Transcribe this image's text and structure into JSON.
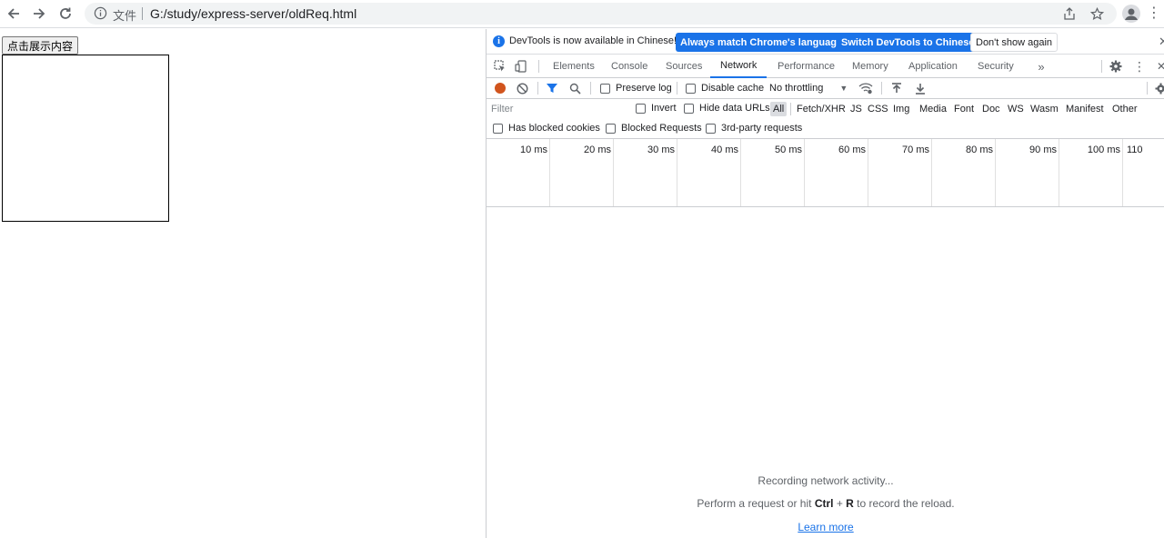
{
  "browser": {
    "protocol_label": "文件",
    "url": "G:/study/express-server/oldReq.html"
  },
  "page": {
    "button_label": "点击展示内容"
  },
  "devtools": {
    "infobar": {
      "text": "DevTools is now available in Chinese!",
      "btn_match": "Always match Chrome's language",
      "btn_switch": "Switch DevTools to Chinese",
      "btn_dismiss": "Don't show again"
    },
    "tabs": [
      "Elements",
      "Console",
      "Sources",
      "Network",
      "Performance",
      "Memory",
      "Application",
      "Security"
    ],
    "active_tab": "Network",
    "network_toolbar": {
      "preserve_log": "Preserve log",
      "disable_cache": "Disable cache",
      "throttling": "No throttling"
    },
    "filter": {
      "placeholder": "Filter",
      "invert": "Invert",
      "hide_data_urls": "Hide data URLs",
      "types": [
        "All",
        "Fetch/XHR",
        "JS",
        "CSS",
        "Img",
        "Media",
        "Font",
        "Doc",
        "WS",
        "Wasm",
        "Manifest",
        "Other"
      ],
      "active_type": "All",
      "has_blocked_cookies": "Has blocked cookies",
      "blocked_requests": "Blocked Requests",
      "third_party": "3rd-party requests"
    },
    "timeline_ticks": [
      "10 ms",
      "20 ms",
      "30 ms",
      "40 ms",
      "50 ms",
      "60 ms",
      "70 ms",
      "80 ms",
      "90 ms",
      "100 ms",
      "110"
    ],
    "empty_state": {
      "line1": "Recording network activity...",
      "line2_prefix": "Perform a request or hit ",
      "line2_key1": "Ctrl",
      "line2_plus": " + ",
      "line2_key2": "R",
      "line2_suffix": " to record the reload.",
      "link": "Learn more"
    }
  }
}
